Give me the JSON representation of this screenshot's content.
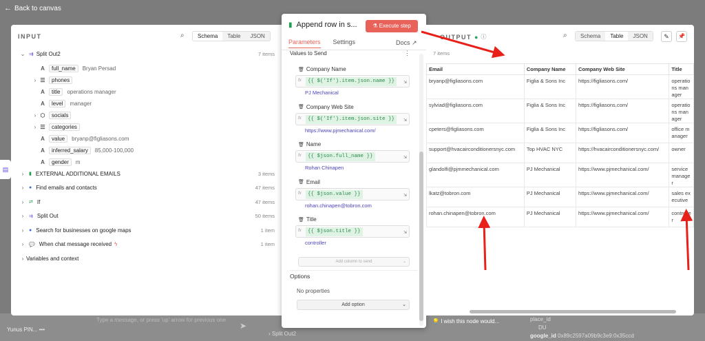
{
  "back_label": "Back to canvas",
  "input": {
    "title": "INPUT",
    "tabs": [
      "Schema",
      "Table",
      "JSON"
    ],
    "active_tab": "Schema",
    "root": {
      "name": "Split Out2",
      "count": "7 items"
    },
    "fields": [
      {
        "type": "A",
        "name": "full_name",
        "value": "Bryan Persad"
      },
      {
        "type": "list",
        "name": "phones",
        "value": ""
      },
      {
        "type": "A",
        "name": "title",
        "value": "operations manager"
      },
      {
        "type": "A",
        "name": "level",
        "value": "manager"
      },
      {
        "type": "obj",
        "name": "socials",
        "value": ""
      },
      {
        "type": "list",
        "name": "categories",
        "value": ""
      },
      {
        "type": "A",
        "name": "value",
        "value": "bryanp@figliasons.com"
      },
      {
        "type": "A",
        "name": "inferred_salary",
        "value": "85,000-100,000"
      },
      {
        "type": "A",
        "name": "gender",
        "value": "m"
      }
    ],
    "nodes": [
      {
        "name": "EXTERNAL ADDITIONAL EMAILS",
        "count": "3 items",
        "icon": "sheets-icon"
      },
      {
        "name": "Find emails and contacts",
        "count": "47 items",
        "icon": "globe-icon"
      },
      {
        "name": "If",
        "count": "47 items",
        "icon": "if-icon"
      },
      {
        "name": "Split Out",
        "count": "50 items",
        "icon": "split-icon"
      },
      {
        "name": "Search for businesses on google maps",
        "count": "1 item",
        "icon": "globe-icon"
      },
      {
        "name": "When chat message received",
        "count": "1 item",
        "icon": "chat-icon"
      }
    ],
    "variables_label": "Variables and context"
  },
  "node": {
    "title": "Append row in s...",
    "execute_label": "Execute step",
    "tabs": [
      "Parameters",
      "Settings"
    ],
    "docs_label": "Docs",
    "values_label": "Values to Send",
    "params": [
      {
        "label": "Company Name",
        "expr": "{{ $('If').item.json.name }}",
        "preview": "PJ Mechanical"
      },
      {
        "label": "Company Web Site",
        "expr": "{{ $('If').item.json.site }}",
        "preview": "https://www.pjmechanical.com/"
      },
      {
        "label": "Name",
        "expr": "{{ $json.full_name }}",
        "preview": "Rohan Chinapen"
      },
      {
        "label": "Email",
        "expr": "{{ $json.value }}",
        "preview": "rohan.chinapen@tobron.com"
      },
      {
        "label": "Title",
        "expr": "{{ $json.title }}",
        "preview": "controller"
      }
    ],
    "add_column_label": "Add column to send",
    "options_label": "Options",
    "no_properties": "No properties",
    "add_option_label": "Add option"
  },
  "output": {
    "title": "OUTPUT",
    "count": "7 items",
    "tabs": [
      "Schema",
      "Table",
      "JSON"
    ],
    "active_tab": "Table",
    "columns": [
      "Email",
      "Company Name",
      "Company Web Site",
      "Title"
    ],
    "rows": [
      [
        "bryanp@figliasons.com",
        "Figlia & Sons Inc",
        "https://figliasons.com/",
        "operations manager"
      ],
      [
        "sylviad@figliasons.com",
        "Figlia & Sons Inc",
        "https://figliasons.com/",
        "operations manager"
      ],
      [
        "cpeters@figliasons.com",
        "Figlia & Sons Inc",
        "https://figliasons.com/",
        "office manager"
      ],
      [
        "support@hvacairconditionersnyc.com",
        "Top HVAC NYC",
        "https://hvacairconditionersnyc.com/",
        "owner"
      ],
      [
        "glandolfi@pjmmechanical.com",
        "PJ Mechanical",
        "https://www.pjmechanical.com/",
        "service manager"
      ],
      [
        "lkatz@tobron.com",
        "PJ Mechanical",
        "https://www.pjmechanical.com/",
        "sales executive"
      ],
      [
        "rohan.chinapen@tobron.com",
        "PJ Mechanical",
        "https://www.pjmechanical.com/",
        "controller"
      ]
    ]
  },
  "footer": {
    "wish": "I wish this node would...",
    "user": "Yunus PIN...",
    "chat_hint": "Type a message, or press 'up' arrow for previous one",
    "split_out": "Split Out2",
    "right_lines": [
      "place_id",
      "DU",
      "google_id",
      "0x89c2597a09b9c3e9:0x35ccd"
    ]
  },
  "colors": {
    "accent": "#e9625a",
    "link": "#4b43b8",
    "expr_bg": "#dff3e4",
    "arrow": "#e8201a"
  }
}
